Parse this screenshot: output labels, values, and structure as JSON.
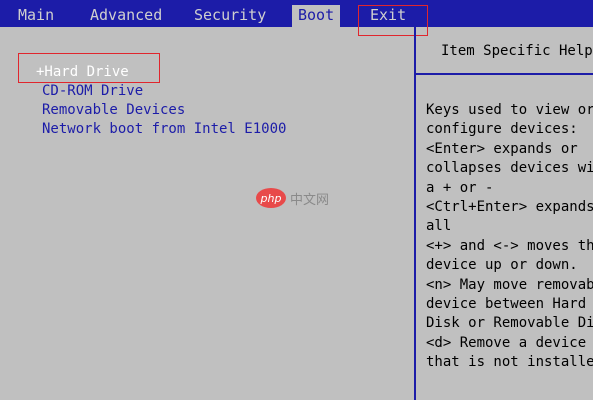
{
  "menubar": {
    "items": [
      {
        "label": "Main"
      },
      {
        "label": "Advanced"
      },
      {
        "label": "Security"
      },
      {
        "label": "Boot"
      },
      {
        "label": "Exit"
      }
    ],
    "active": "Boot"
  },
  "boot_list": {
    "items": [
      {
        "label": "+Hard Drive"
      },
      {
        "label": "CD-ROM Drive"
      },
      {
        "label": "Removable Devices"
      },
      {
        "label": "Network boot from Intel E1000"
      }
    ]
  },
  "help": {
    "title": "Item Specific Help",
    "lines": [
      "Keys used to view or",
      "configure devices:",
      "<Enter> expands or",
      "collapses devices wit",
      "a + or -",
      "<Ctrl+Enter> expands",
      "all",
      "<+> and <-> moves the",
      "device up or down.",
      "<n> May move removabl",
      "device between Hard",
      "Disk or Removable Dis",
      "<d> Remove a device",
      "that is not installed"
    ]
  },
  "watermark": {
    "logo": "php",
    "text": "中文网"
  },
  "colors": {
    "menubar_bg": "#1c1ca8",
    "screen_bg": "#c0c0c0",
    "highlight": "#e0262d",
    "text_blue": "#1c1ca8"
  }
}
